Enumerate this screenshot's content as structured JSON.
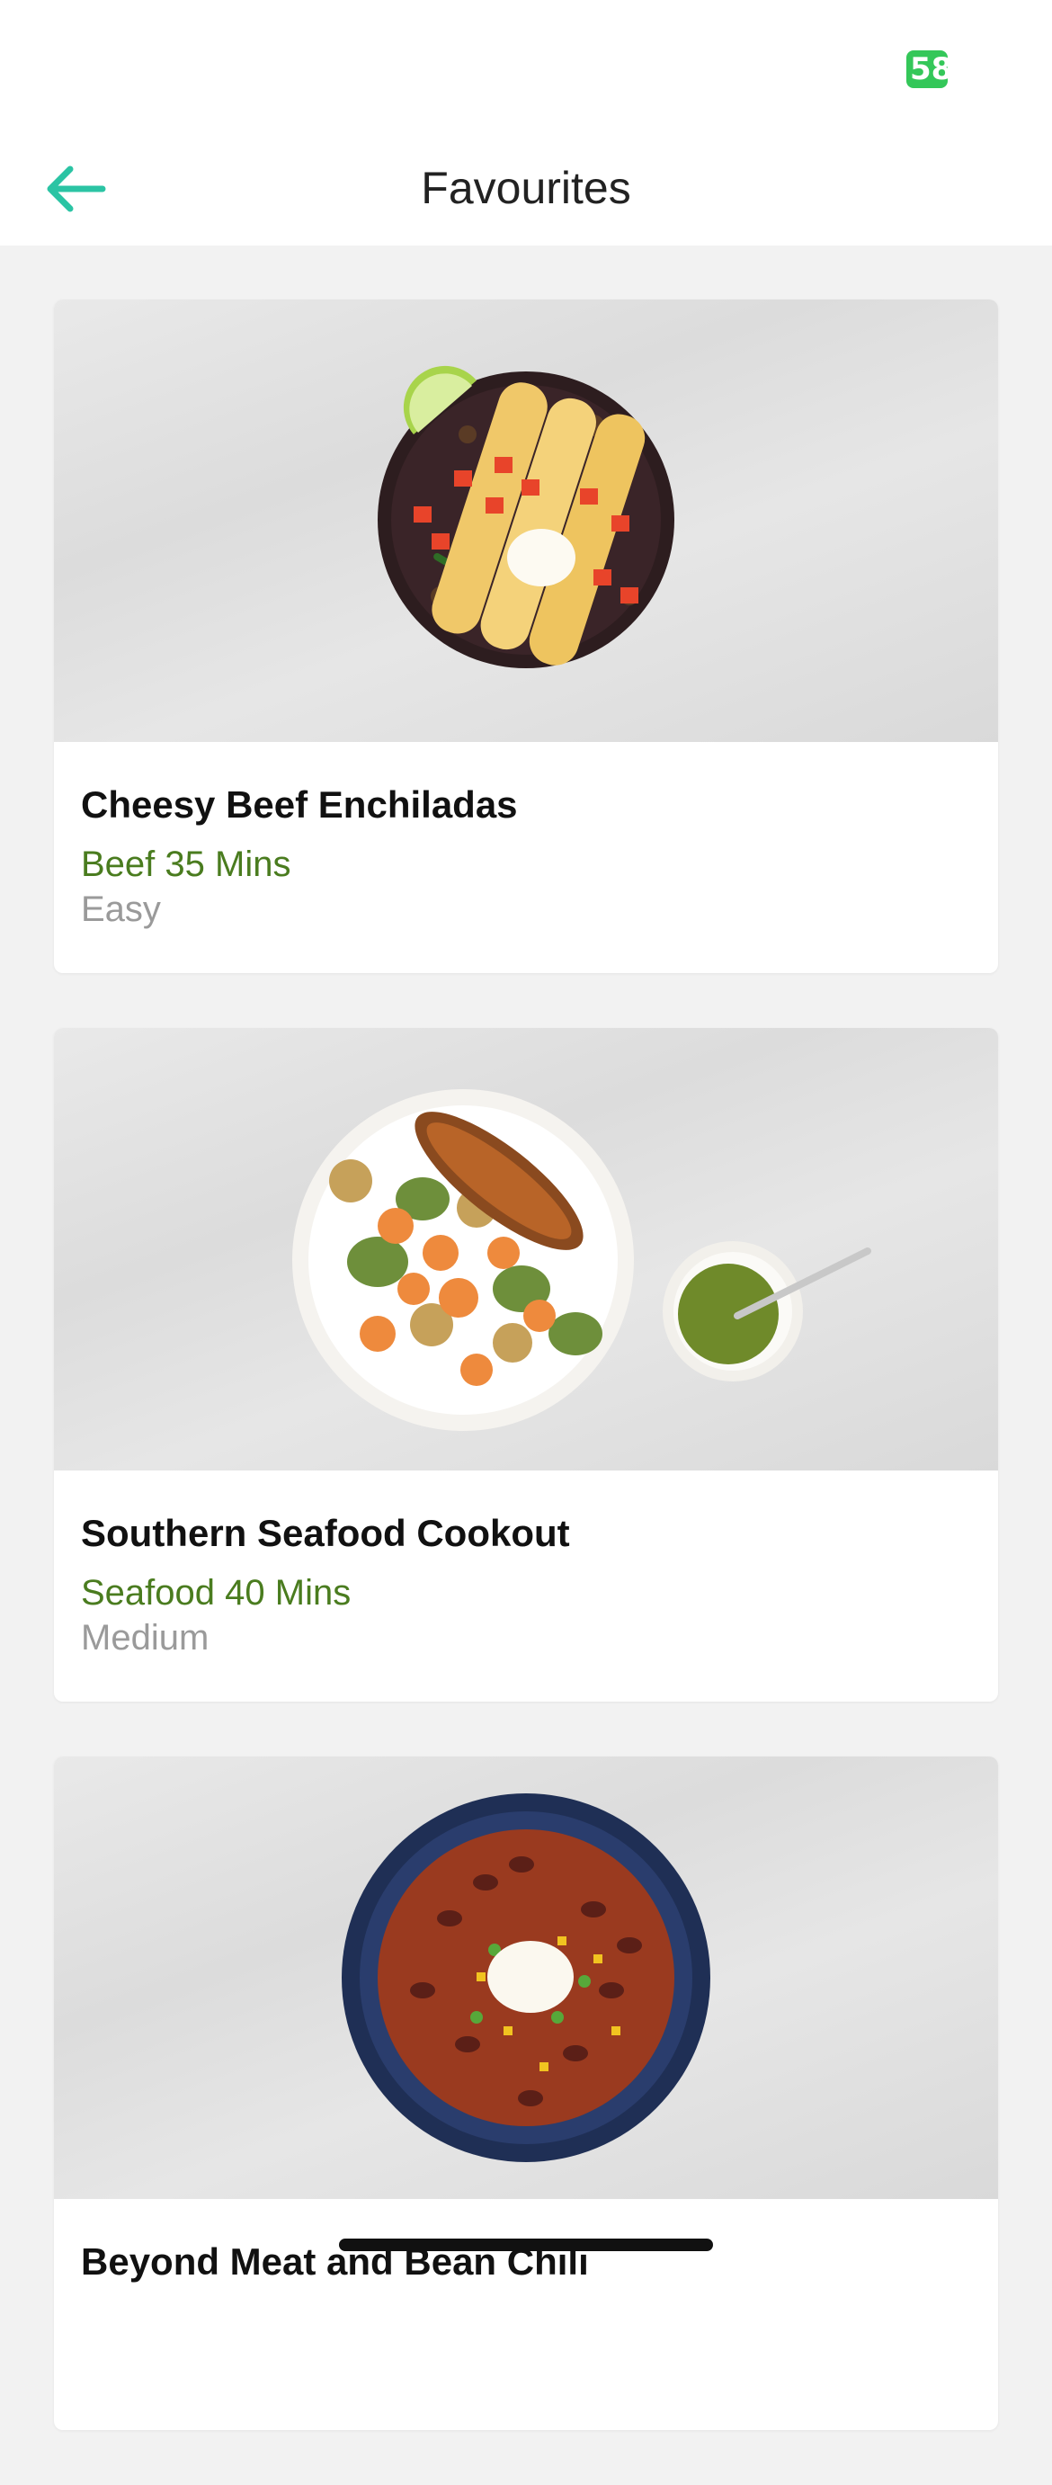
{
  "status_bar": {
    "battery_level": "58"
  },
  "nav": {
    "title": "Favourites",
    "back_icon": "arrow-left-icon",
    "accent_color": "#2bc4a4"
  },
  "recipes": [
    {
      "title": "Cheesy Beef Enchiladas",
      "meta": "Beef 35 Mins",
      "difficulty": "Easy"
    },
    {
      "title": "Southern Seafood Cookout",
      "meta": "Seafood 40 Mins",
      "difficulty": "Medium"
    },
    {
      "title": "Beyond Meat and Bean Chili",
      "meta": "",
      "difficulty": ""
    }
  ],
  "colors": {
    "meta_green": "#4a7c1f",
    "difficulty_gray": "#9a9a9a"
  }
}
